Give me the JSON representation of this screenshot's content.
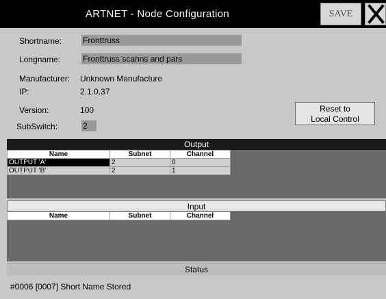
{
  "window": {
    "title": "ARTNET - Node Configuration",
    "save_label": "SAVE",
    "close_icon": "close-icon"
  },
  "node": {
    "shortname_label": "Shortname:",
    "shortname_value": "Fronttruss",
    "longname_label": "Longname:",
    "longname_value": "Fronttruss scanns and pars",
    "manufacturer_label": "Manufacturer:",
    "manufacturer_value": "Unknown Manufacturе",
    "ip_label": "IP:",
    "ip_value": "2.1.0.37",
    "version_label": "Version:",
    "version_value": "100",
    "subswitch_label": "SubSwitch:",
    "subswitch_value": "2",
    "reset_line1": "Reset to",
    "reset_line2": "Local Control"
  },
  "output": {
    "header": "Output",
    "columns": [
      "Name",
      "Subnet",
      "Channel"
    ],
    "rows": [
      {
        "name": "OUTPUT 'A'",
        "subnet": "2",
        "channel": "0",
        "selected": true
      },
      {
        "name": "OUTPUT 'B'",
        "subnet": "2",
        "channel": "1",
        "selected": false
      }
    ]
  },
  "input": {
    "header": "Input",
    "columns": [
      "Name",
      "Subnet",
      "Channel"
    ],
    "rows": []
  },
  "status": {
    "header": "Status",
    "message": "#0006 [0007] Short Name Stored"
  },
  "colors": {
    "titlebar": "#000000",
    "panel": "#696969",
    "background": "#c8c8c8",
    "field": "#9a9a9a"
  }
}
